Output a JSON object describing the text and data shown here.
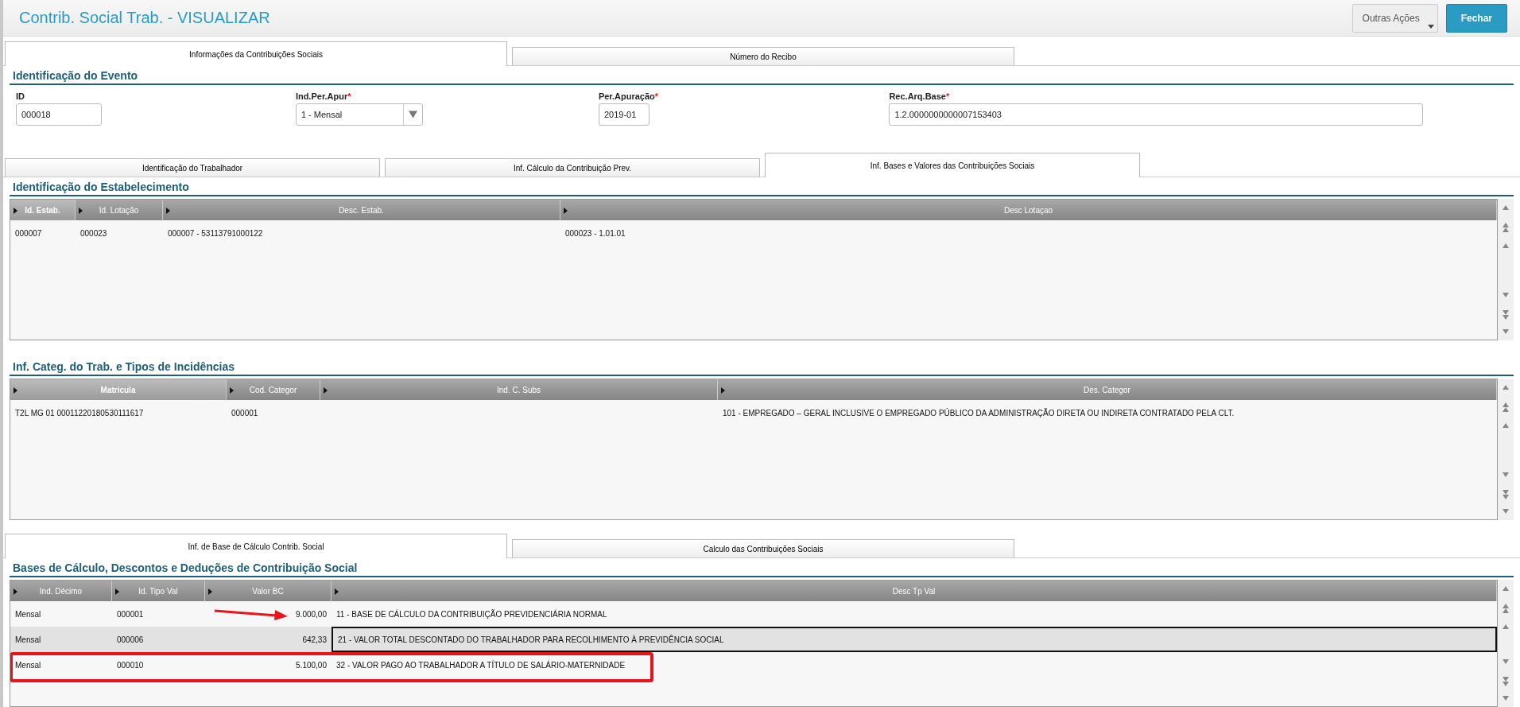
{
  "header": {
    "title": "Contrib. Social Trab. - VISUALIZAR",
    "buttons": [
      {
        "label": "Outras Ações",
        "kind": "menu"
      },
      {
        "label": "Fechar",
        "kind": "primary"
      }
    ]
  },
  "top_tabs": [
    {
      "label": "Informações da Contribuições Sociais",
      "selected": true
    },
    {
      "label": "Número do Recibo",
      "selected": false
    }
  ],
  "event_section": {
    "title": "Identificação do Evento",
    "fields": [
      {
        "label": "ID",
        "value": "000018",
        "kind": "text"
      },
      {
        "label": "Ind.Per.Apur",
        "required_mark": "*",
        "value": "1 - Mensal",
        "kind": "select"
      },
      {
        "label": "Per.Apuração",
        "required_mark": "*",
        "value": "2019-01",
        "kind": "text"
      },
      {
        "label": "Rec.Arq.Base",
        "required_mark": "*",
        "value": "1.2.0000000000007153403",
        "kind": "text"
      }
    ]
  },
  "inner_tabs": [
    {
      "label": "Identificação do Trabalhador",
      "selected": false
    },
    {
      "label": "Inf. Cálculo da Contribuição Prev.",
      "selected": false
    },
    {
      "label": "Inf. Bases e Valores das Contribuições Sociais",
      "selected": true
    }
  ],
  "establishment_grid": {
    "title": "Identificação do Estabelecimento",
    "columns": [
      {
        "label": "Id. Estab.",
        "sorted": true
      },
      {
        "label": "Id. Lotação",
        "sorted": false
      },
      {
        "label": "Desc. Estab.",
        "sorted": false
      },
      {
        "label": "Desc Lotaçao",
        "sorted": false
      }
    ],
    "rows": [
      {
        "selected": false,
        "cells": [
          "000007",
          "000023",
          "000007 - 53113791000122",
          "000023 - 1.01.01"
        ]
      }
    ]
  },
  "category_grid": {
    "title": "Inf. Categ. do Trab. e Tipos de Incidências",
    "columns": [
      {
        "label": "Matricula",
        "sorted": true
      },
      {
        "label": "Cod. Categor",
        "sorted": false
      },
      {
        "label": "Ind. C. Subs",
        "sorted": false
      },
      {
        "label": "Des. Categor",
        "sorted": false
      }
    ],
    "rows": [
      {
        "selected": false,
        "cells": [
          "T2L MG 01 00011220180530111617",
          "000001",
          "",
          "101 - EMPREGADO – GERAL INCLUSIVE O EMPREGADO PÚBLICO DA ADMINISTRAÇÃO DIRETA OU INDIRETA CONTRATADO PELA CLT."
        ]
      }
    ]
  },
  "bottom_tabs": [
    {
      "label": "Inf. de Base de Cálculo Contrib. Social",
      "selected": true
    },
    {
      "label": "Calculo das Contribuições Sociais",
      "selected": false
    }
  ],
  "bases_grid": {
    "title": "Bases de Cálculo, Descontos e Deduções de Contribuição Social",
    "columns": [
      {
        "label": "Ind. Décimo",
        "sorted": false
      },
      {
        "label": "Id. Tipo Val",
        "sorted": false
      },
      {
        "label": "Valor BC",
        "sorted": false
      },
      {
        "label": "Desc Tp Val",
        "sorted": false
      }
    ],
    "rows": [
      {
        "selected": false,
        "cells": [
          "Mensal",
          "000001",
          "9.000,00",
          "11 - BASE DE CÁLCULO DA CONTRIBUIÇÃO PREVIDENCIÁRIA NORMAL"
        ]
      },
      {
        "selected": true,
        "cells": [
          "Mensal",
          "000006",
          "642,33",
          "21 - VALOR TOTAL DESCONTADO DO TRABALHADOR PARA RECOLHIMENTO À PREVIDÊNCIA SOCIAL"
        ]
      },
      {
        "selected": false,
        "cells": [
          "Mensal",
          "000010",
          "5.100,00",
          "32 - VALOR PAGO AO TRABALHADOR A TÍTULO DE SALÁRIO-MATERNIDADE"
        ]
      }
    ]
  }
}
